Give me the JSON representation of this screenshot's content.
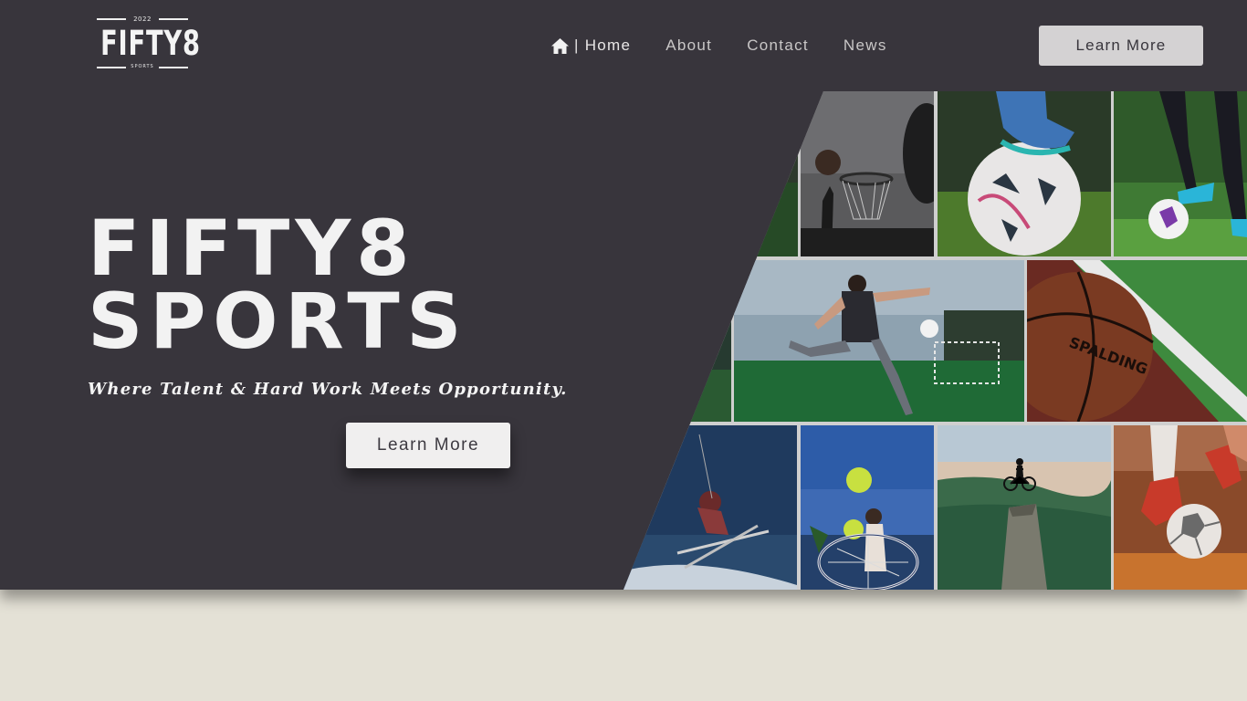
{
  "logo": {
    "year": "2022",
    "word": "FIFTY8",
    "sub": "SPORTS"
  },
  "nav": {
    "home_icon": "home-icon",
    "separator": "|",
    "items": [
      {
        "label": "Home"
      },
      {
        "label": "About"
      },
      {
        "label": "Contact"
      },
      {
        "label": "News"
      }
    ]
  },
  "header": {
    "cta_label": "Learn More"
  },
  "hero": {
    "title_line1": "FIFTY8",
    "title_line2": "SPORTS",
    "tagline": "Where Talent & Hard Work Meets Opportunity.",
    "cta_label": "Learn More"
  },
  "collage": {
    "tiles": [
      {
        "name": "basketball-hoop-photo"
      },
      {
        "name": "football-under-foot-photo"
      },
      {
        "name": "player-dribbling-photo"
      },
      {
        "name": "soccer-kick-photo"
      },
      {
        "name": "spalding-basketball-photo"
      },
      {
        "name": "skier-jump-photo"
      },
      {
        "name": "tennis-player-photo"
      },
      {
        "name": "cyclist-mountain-photo"
      },
      {
        "name": "futsal-ball-photo"
      }
    ]
  },
  "colors": {
    "hero_bg": "#38353c",
    "page_bg": "#e4e1d6",
    "button_bg": "#d4d2d3"
  }
}
